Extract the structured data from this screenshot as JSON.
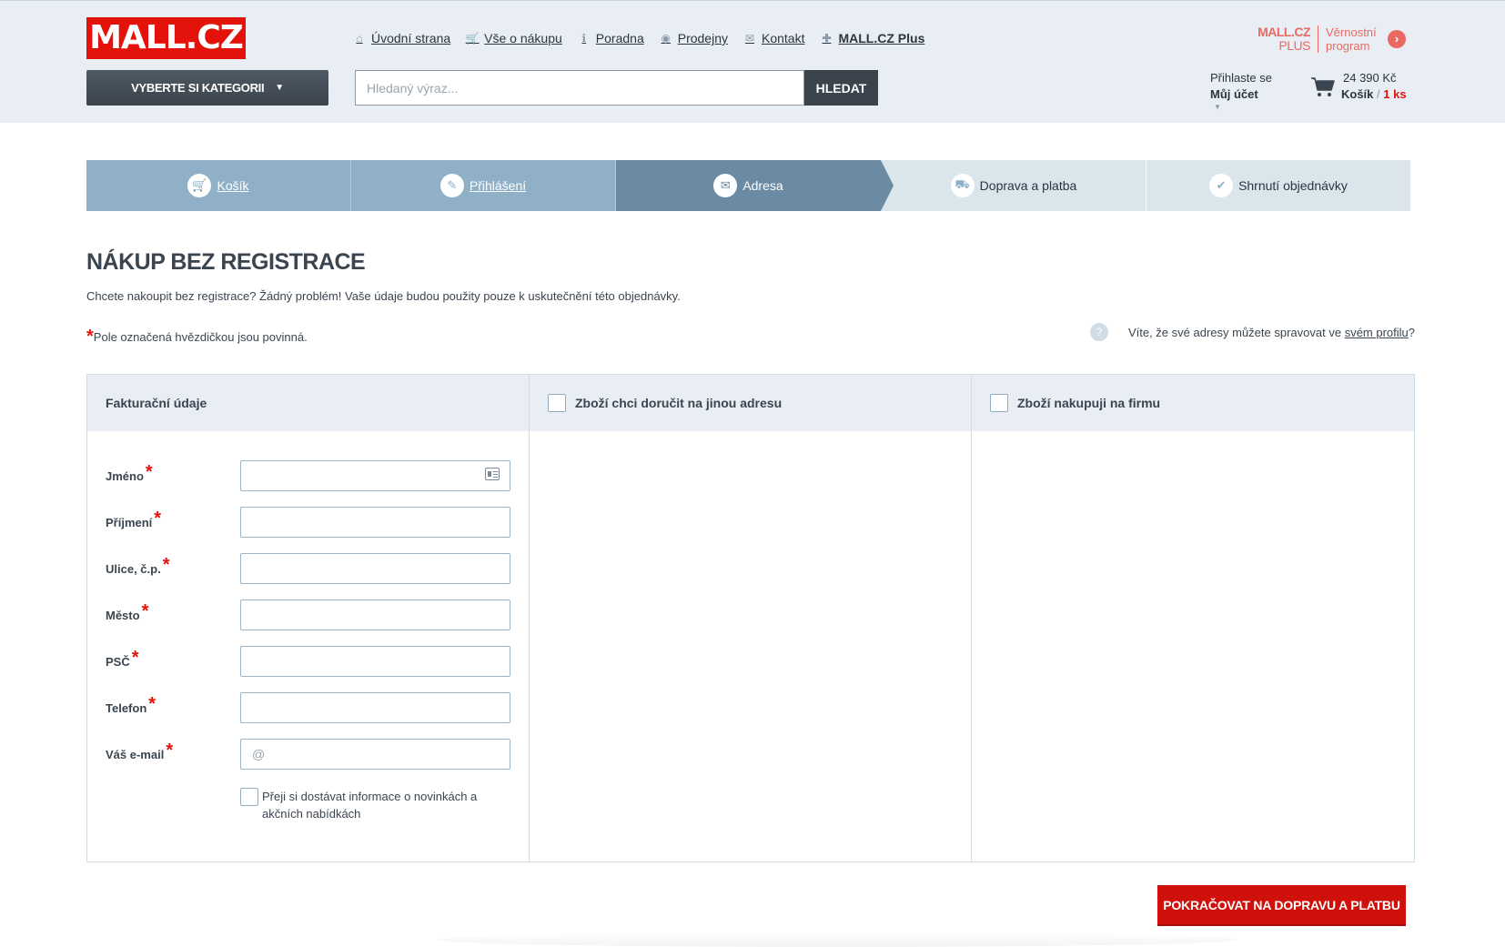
{
  "header": {
    "logo": "MALL.CZ",
    "nav": [
      {
        "label": "Úvodní strana",
        "icon": "home-icon",
        "glyph": "⌂"
      },
      {
        "label": "Vše o nákupu",
        "icon": "cart-small-icon",
        "glyph": "🛒"
      },
      {
        "label": "Poradna",
        "icon": "info-icon",
        "glyph": "ℹ"
      },
      {
        "label": "Prodejny",
        "icon": "location-icon",
        "glyph": "◉"
      },
      {
        "label": "Kontakt",
        "icon": "mail-icon",
        "glyph": "✉"
      },
      {
        "label": "MALL.CZ Plus",
        "icon": "plus-icon",
        "glyph": "✚"
      }
    ],
    "plus": {
      "logo_top": "MALL.CZ",
      "logo_bottom": "PLUS",
      "text": "Věrnostní program",
      "arrow": "›"
    },
    "category_button": "VYBERTE SI KATEGORII",
    "search": {
      "placeholder": "Hledaný výraz...",
      "value": "",
      "button": "HLEDAT"
    },
    "account": {
      "line1": "Přihlaste se",
      "line2": "Můj účet"
    },
    "cart": {
      "price": "24 390 Kč",
      "label": "Košík",
      "separator": " / ",
      "count": "1 ks"
    }
  },
  "steps": [
    {
      "label": "Košík",
      "state": "done",
      "icon": "cart-step-icon",
      "glyph": "🛒"
    },
    {
      "label": "Přihlášení",
      "state": "done",
      "icon": "pencil-icon",
      "glyph": "✎"
    },
    {
      "label": "Adresa",
      "state": "active",
      "icon": "envelope-icon",
      "glyph": "✉"
    },
    {
      "label": "Doprava a platba",
      "state": "todo",
      "icon": "truck-icon",
      "glyph": "⛟"
    },
    {
      "label": "Shrnutí objednávky",
      "state": "todo",
      "icon": "check-icon",
      "glyph": "✔"
    }
  ],
  "page": {
    "title": "NÁKUP BEZ REGISTRACE",
    "intro": "Chcete nakoupit bez registrace? Žádný problém! Vaše údaje budou použity pouze k uskutečnění této objednávky.",
    "required_star": "*",
    "required_note": "Pole označená hvězdičkou jsou povinná.",
    "profile_note_before": "Víte, že své adresy můžete spravovat ve ",
    "profile_link": "svém profilu",
    "profile_note_after": "?",
    "help_glyph": "?"
  },
  "form": {
    "billing_title": "Fakturační údaje",
    "delivery_title": "Zboží chci doručit na jinou adresu",
    "company_title": "Zboží nakupuji na firmu",
    "fields": [
      {
        "label": "Jméno",
        "value": "",
        "placeholder": ""
      },
      {
        "label": "Příjmení",
        "value": "",
        "placeholder": ""
      },
      {
        "label": "Ulice, č.p.",
        "value": "",
        "placeholder": ""
      },
      {
        "label": "Město",
        "value": "",
        "placeholder": ""
      },
      {
        "label": "PSČ",
        "value": "",
        "placeholder": ""
      },
      {
        "label": "Telefon",
        "value": "",
        "placeholder": ""
      },
      {
        "label": "Váš e-mail",
        "value": "",
        "placeholder": "@"
      }
    ],
    "newsletter": "Přeji si dostávat informace o novinkách a akčních nabídkách"
  },
  "continue_button": "POKRAČOVAT NA DOPRAVU A PLATBU",
  "colors": {
    "brand_red": "#e3120b",
    "step_done": "#8fb0c6",
    "step_active": "#6a8ba3",
    "plus": "#e86a63"
  }
}
